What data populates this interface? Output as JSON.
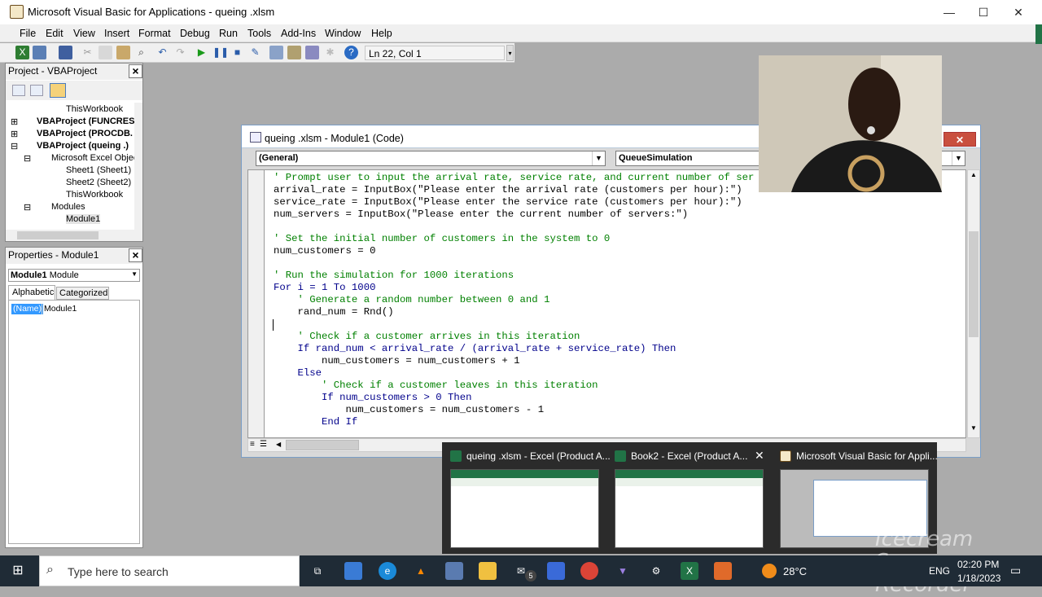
{
  "window": {
    "title": "Microsoft Visual Basic for Applications - queing .xlsm",
    "minimize_icon": "—",
    "maximize_icon": "☐",
    "close_icon": "✕"
  },
  "menu": [
    "File",
    "Edit",
    "View",
    "Insert",
    "Format",
    "Debug",
    "Run",
    "Tools",
    "Add-Ins",
    "Window",
    "Help"
  ],
  "toolbar": {
    "position": "Ln 22, Col 1"
  },
  "project_panel": {
    "title": "Project - VBAProject",
    "items": [
      "ThisWorkbook",
      "VBAProject (FUNCRES",
      "VBAProject (PROCDB.",
      "VBAProject (queing .)",
      "Microsoft Excel Objec",
      "Sheet1 (Sheet1)",
      "Sheet2 (Sheet2)",
      "ThisWorkbook",
      "Modules",
      "Module1"
    ]
  },
  "properties_panel": {
    "title": "Properties - Module1",
    "object_name": "Module1",
    "object_type": "Module",
    "tab_alphabetic": "Alphabetic",
    "tab_categorized": "Categorized",
    "prop_name": "(Name)",
    "prop_value": "Module1"
  },
  "code_window": {
    "title": "queing .xlsm - Module1 (Code)",
    "object_combo": "(General)",
    "proc_combo": "QueueSimulation",
    "lines": [
      {
        "text": "' Prompt user to input the arrival rate, service rate, and current number of ser",
        "type": "comment"
      },
      {
        "text": "arrival_rate = InputBox(\"Please enter the arrival rate (customers per hour):\")",
        "type": "code"
      },
      {
        "text": "service_rate = InputBox(\"Please enter the service rate (customers per hour):\")",
        "type": "code"
      },
      {
        "text": "num_servers = InputBox(\"Please enter the current number of servers:\")",
        "type": "code"
      },
      {
        "text": "",
        "type": "code"
      },
      {
        "text": "' Set the initial number of customers in the system to 0",
        "type": "comment"
      },
      {
        "text": "num_customers = 0",
        "type": "code"
      },
      {
        "text": "",
        "type": "code"
      },
      {
        "text": "' Run the simulation for 1000 iterations",
        "type": "comment"
      },
      {
        "text": "For i = 1 To 1000",
        "type": "code"
      },
      {
        "text": "    ' Generate a random number between 0 and 1",
        "type": "comment"
      },
      {
        "text": "    rand_num = Rnd()",
        "type": "code"
      },
      {
        "text": "",
        "type": "code"
      },
      {
        "text": "    ' Check if a customer arrives in this iteration",
        "type": "comment"
      },
      {
        "text": "    If rand_num < arrival_rate / (arrival_rate + service_rate) Then",
        "type": "code"
      },
      {
        "text": "        num_customers = num_customers + 1",
        "type": "code"
      },
      {
        "text": "    Else",
        "type": "code"
      },
      {
        "text": "        ' Check if a customer leaves in this iteration",
        "type": "comment"
      },
      {
        "text": "        If num_customers > 0 Then",
        "type": "code"
      },
      {
        "text": "            num_customers = num_customers - 1",
        "type": "code"
      },
      {
        "text": "        End If",
        "type": "code"
      }
    ]
  },
  "taskbar_previews": [
    {
      "title": "queing .xlsm - Excel (Product A..."
    },
    {
      "title": "Book2 - Excel (Product A..."
    },
    {
      "title": "Microsoft Visual Basic for Appli..."
    }
  ],
  "taskbar": {
    "search_placeholder": "Type here to search",
    "badge": "5",
    "temperature": "28°C",
    "language": "ENG",
    "time": "02:20 PM",
    "date": "1/18/2023"
  },
  "watermark": [
    "Icecream",
    "Screen Recorder"
  ],
  "colors": {
    "comment": "#008000",
    "keyword": "#00008b",
    "excel_green": "#217346",
    "taskbar": "#1f2b36"
  }
}
